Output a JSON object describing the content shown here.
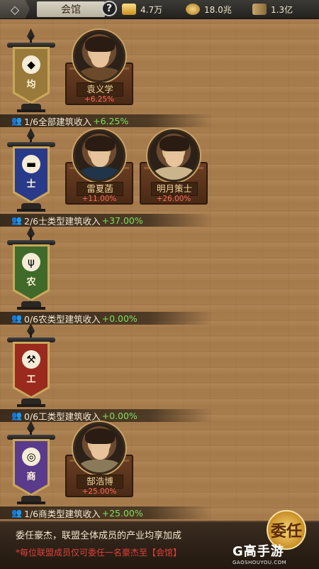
{
  "topbar": {
    "title": "会馆",
    "help": "?",
    "resources": [
      {
        "icon": "gold-ingot-icon",
        "value": "4.7万"
      },
      {
        "icon": "coin-icon",
        "value": "18.0兆"
      },
      {
        "icon": "scroll-icon",
        "value": "1.3亿"
      }
    ]
  },
  "sections": [
    {
      "banner_char": "均",
      "banner_color": "#9a7a3a",
      "emblem": "◆",
      "summary_text": "1/6全部建筑收入",
      "summary_bonus": "+6.25%",
      "heroes": [
        {
          "name": "袁义学",
          "bonus": "+6.25%",
          "robe": "#6b4a2c"
        }
      ]
    },
    {
      "banner_char": "士",
      "banner_color": "#2a3a8a",
      "emblem": "▬",
      "summary_text": "2/6士类型建筑收入",
      "summary_bonus": "+37.00%",
      "heroes": [
        {
          "name": "雷夏菡",
          "bonus": "+11.00%",
          "robe": "#20344a"
        },
        {
          "name": "明月策士",
          "bonus": "+26.00%",
          "robe": "#c9b48c"
        }
      ]
    },
    {
      "banner_char": "农",
      "banner_color": "#3f6a2a",
      "emblem": "ψ",
      "summary_text": "0/6农类型建筑收入",
      "summary_bonus": "+0.00%",
      "heroes": []
    },
    {
      "banner_char": "工",
      "banner_color": "#9a2a1e",
      "emblem": "⚒",
      "summary_text": "0/6工类型建筑收入",
      "summary_bonus": "+0.00%",
      "heroes": []
    },
    {
      "banner_char": "商",
      "banner_color": "#5a3a8a",
      "emblem": "◎",
      "summary_text": "1/6商类型建筑收入",
      "summary_bonus": "+25.00%",
      "heroes": [
        {
          "name": "郜浩博",
          "bonus": "+25.00%",
          "robe": "#8a7a5a"
        }
      ]
    }
  ],
  "footer": {
    "line1": "委任豪杰，联盟全体成员的产业均享加成",
    "line2": "*每位联盟成员仅可委任一名豪杰至【会馆】",
    "appoint_label": "委任"
  },
  "watermark": {
    "brand": "G高手游",
    "url": "GAOSHOUYOU.COM"
  }
}
